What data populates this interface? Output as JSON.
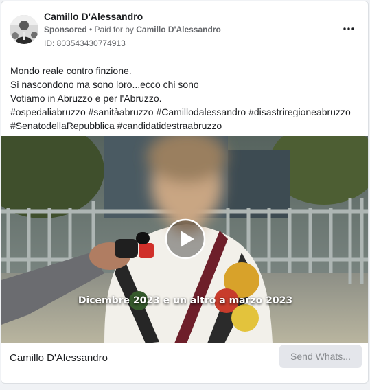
{
  "post": {
    "advertiser_name": "Camillo D'Alessandro",
    "sponsored_label": "Sponsored",
    "separator": " • ",
    "paid_for_prefix": "Paid for by ",
    "payer_name": "Camillo D'Alessandro",
    "library_id": "ID: 803543430774913",
    "more_icon": "more-horizontal-icon",
    "text_lines": [
      "Mondo reale contro finzione.",
      "Si nascondono ma sono loro...ecco chi sono",
      "Votiamo in Abruzzo e per l'Abruzzo.",
      "#ospedaliabruzzo #sanitàabruzzo #Camillodalessandro #disastriregioneabruzzo",
      "#SenatodellaRepubblica #candidatidestraabruzzo"
    ]
  },
  "video": {
    "caption": "Dicembre 2023 e un altro a marzo 2023",
    "play_icon": "play-icon"
  },
  "footer": {
    "page_name": "Camillo D'Alessandro",
    "cta_label": "Send Whats..."
  }
}
